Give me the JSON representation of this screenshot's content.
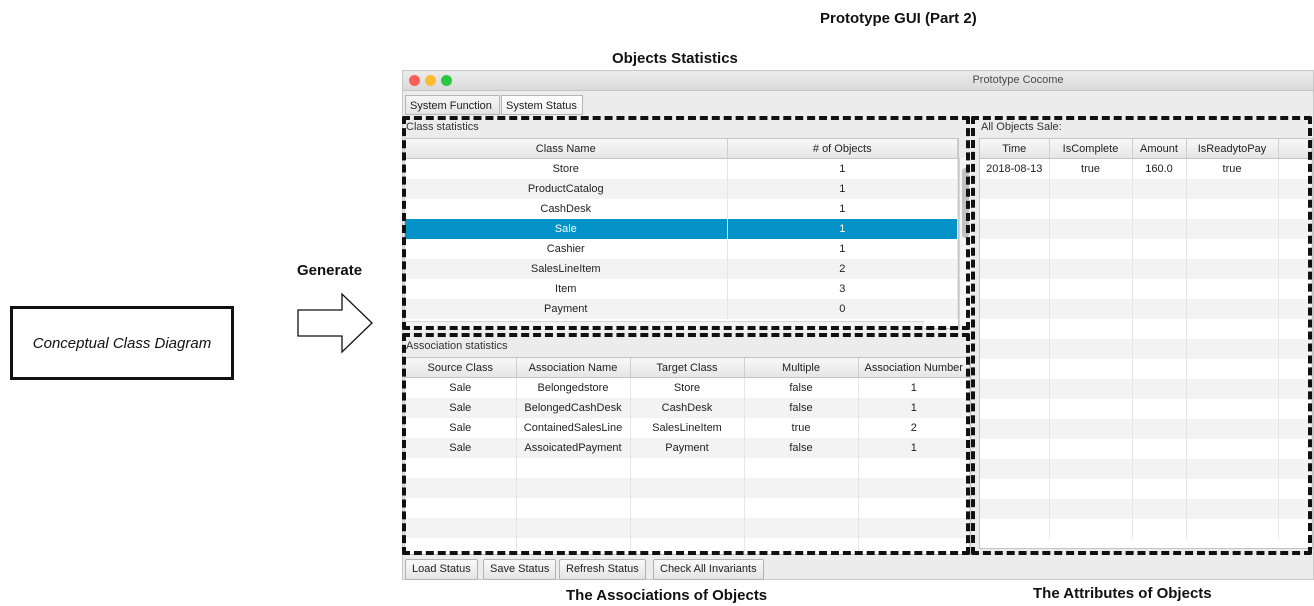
{
  "headings": {
    "top": "Prototype GUI (Part 2)",
    "objects_statistics": "Objects Statistics",
    "associations": "The Associations of Objects",
    "attributes": "The Attributes of Objects"
  },
  "left": {
    "box_label": "Conceptual Class Diagram",
    "arrow_label": "Generate"
  },
  "window": {
    "title": "Prototype Cocome",
    "tabs": [
      "System Function",
      "System Status"
    ],
    "class_stats": {
      "label": "Class statistics",
      "columns": [
        "Class Name",
        "# of Objects"
      ],
      "rows": [
        [
          "Store",
          "1"
        ],
        [
          "ProductCatalog",
          "1"
        ],
        [
          "CashDesk",
          "1"
        ],
        [
          "Sale",
          "1"
        ],
        [
          "Cashier",
          "1"
        ],
        [
          "SalesLineItem",
          "2"
        ],
        [
          "Item",
          "3"
        ],
        [
          "Payment",
          "0"
        ]
      ],
      "selected_row": 3
    },
    "assoc_stats": {
      "label": "Association statistics",
      "columns": [
        "Source Class",
        "Association Name",
        "Target Class",
        "Multiple",
        "Association Number"
      ],
      "rows": [
        [
          "Sale",
          "Belongedstore",
          "Store",
          "false",
          "1"
        ],
        [
          "Sale",
          "BelongedCashDesk",
          "CashDesk",
          "false",
          "1"
        ],
        [
          "Sale",
          "ContainedSalesLine",
          "SalesLineItem",
          "true",
          "2"
        ],
        [
          "Sale",
          "AssoicatedPayment",
          "Payment",
          "false",
          "1"
        ]
      ]
    },
    "sale_objects": {
      "label": "All Objects Sale:",
      "columns": [
        "Time",
        "IsComplete",
        "Amount",
        "IsReadytoPay"
      ],
      "rows": [
        [
          "2018-08-13",
          "true",
          "160.0",
          "true"
        ]
      ]
    },
    "buttons": [
      "Load Status",
      "Save Status",
      "Refresh Status",
      "Check All Invariants"
    ]
  },
  "colors": {
    "selected_row": "#0493c9",
    "dash_border": "#111111"
  }
}
